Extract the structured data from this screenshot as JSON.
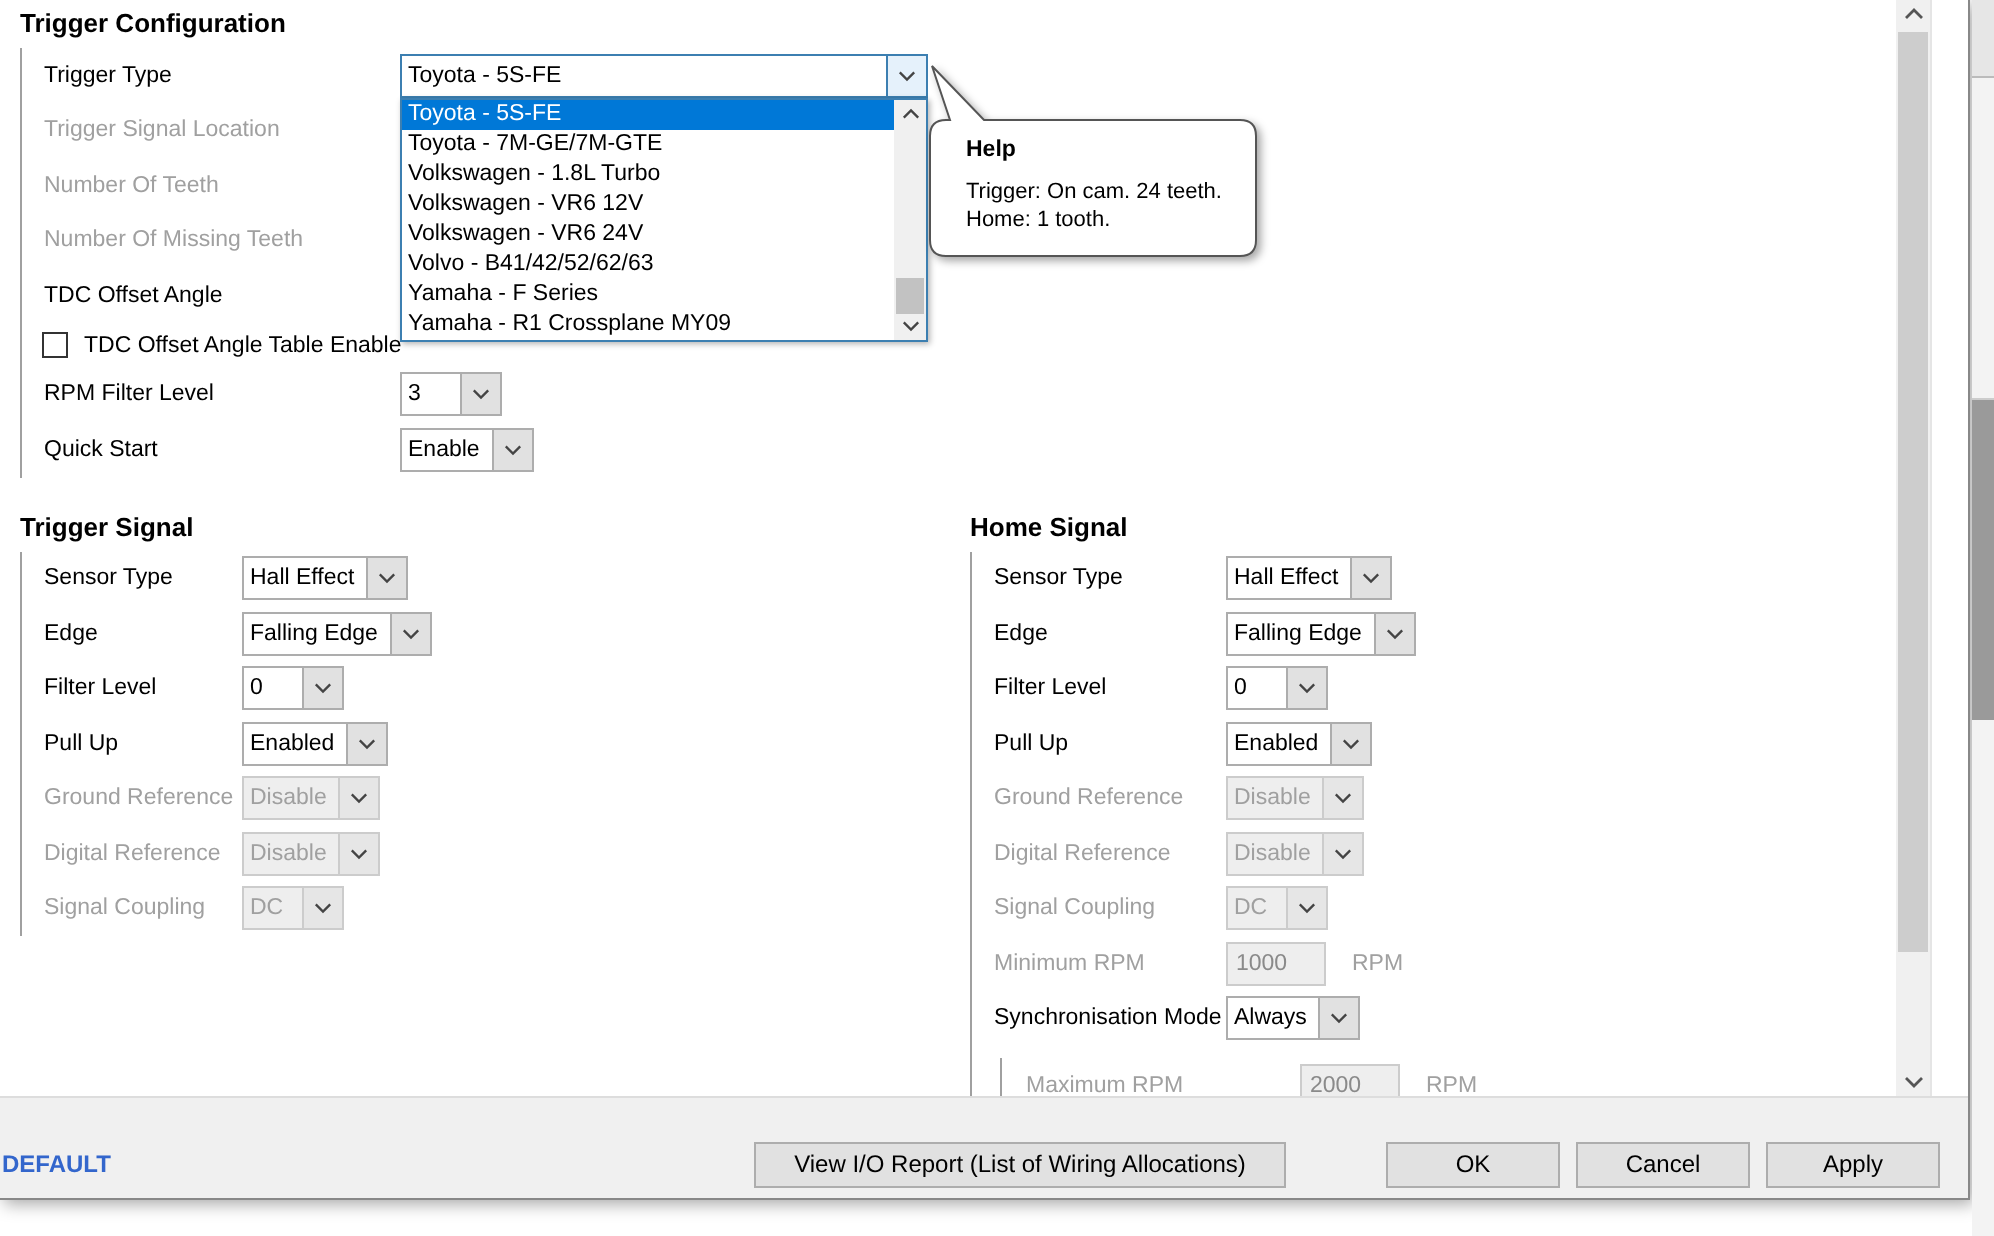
{
  "config": {
    "title": "Trigger Configuration",
    "rows": [
      {
        "kind": "combo",
        "label": "Trigger Type",
        "disabled": false,
        "value": "Toyota - 5S-FE",
        "expanded": true,
        "options": [
          {
            "label": "Toyota - 5S-FE",
            "selected": true
          },
          {
            "label": "Toyota - 7M-GE/7M-GTE",
            "selected": false
          },
          {
            "label": "Volkswagen - 1.8L Turbo",
            "selected": false
          },
          {
            "label": "Volkswagen - VR6 12V",
            "selected": false
          },
          {
            "label": "Volkswagen - VR6 24V",
            "selected": false
          },
          {
            "label": "Volvo - B41/42/52/62/63",
            "selected": false
          },
          {
            "label": "Yamaha - F Series",
            "selected": false
          },
          {
            "label": "Yamaha - R1 Crossplane MY09",
            "selected": false
          }
        ],
        "help": {
          "title": "Help",
          "lines": [
            "Trigger: On cam. 24 teeth.",
            "Home: 1 tooth."
          ]
        }
      },
      {
        "kind": "label",
        "label": "Trigger Signal Location",
        "disabled": true
      },
      {
        "kind": "label",
        "label": "Number Of Teeth",
        "disabled": true
      },
      {
        "kind": "label",
        "label": "Number Of Missing Teeth",
        "disabled": true
      },
      {
        "kind": "label",
        "label": "TDC Offset Angle",
        "disabled": false
      },
      {
        "kind": "checkbox",
        "label": "TDC Offset Angle Table Enable",
        "checked": false
      },
      {
        "kind": "combo",
        "label": "RPM Filter Level",
        "disabled": false,
        "value": "3",
        "expanded": false
      },
      {
        "kind": "combo",
        "label": "Quick Start",
        "disabled": false,
        "value": "Enable",
        "expanded": false
      }
    ]
  },
  "signals": [
    {
      "title": "Trigger Signal",
      "rows": [
        {
          "kind": "combo",
          "label": "Sensor Type",
          "disabled": false,
          "value": "Hall Effect",
          "expanded": false
        },
        {
          "kind": "combo",
          "label": "Edge",
          "disabled": false,
          "value": "Falling Edge",
          "expanded": false
        },
        {
          "kind": "combo",
          "label": "Filter Level",
          "disabled": false,
          "value": "0",
          "expanded": false
        },
        {
          "kind": "combo",
          "label": "Pull Up",
          "disabled": false,
          "value": "Enabled",
          "expanded": false
        },
        {
          "kind": "combo",
          "label": "Ground Reference",
          "disabled": true,
          "value": "Disable",
          "expanded": false
        },
        {
          "kind": "combo",
          "label": "Digital Reference",
          "disabled": true,
          "value": "Disable",
          "expanded": false
        },
        {
          "kind": "combo",
          "label": "Signal Coupling",
          "disabled": true,
          "value": "DC",
          "expanded": false
        }
      ]
    },
    {
      "title": "Home Signal",
      "rows": [
        {
          "kind": "combo",
          "label": "Sensor Type",
          "disabled": false,
          "value": "Hall Effect",
          "expanded": false
        },
        {
          "kind": "combo",
          "label": "Edge",
          "disabled": false,
          "value": "Falling Edge",
          "expanded": false
        },
        {
          "kind": "combo",
          "label": "Filter Level",
          "disabled": false,
          "value": "0",
          "expanded": false
        },
        {
          "kind": "combo",
          "label": "Pull Up",
          "disabled": false,
          "value": "Enabled",
          "expanded": false
        },
        {
          "kind": "combo",
          "label": "Ground Reference",
          "disabled": true,
          "value": "Disable",
          "expanded": false
        },
        {
          "kind": "combo",
          "label": "Digital Reference",
          "disabled": true,
          "value": "Disable",
          "expanded": false
        },
        {
          "kind": "combo",
          "label": "Signal Coupling",
          "disabled": true,
          "value": "DC",
          "expanded": false
        },
        {
          "kind": "number",
          "label": "Minimum RPM",
          "disabled": true,
          "value": "1000",
          "unit": "RPM"
        },
        {
          "kind": "combo",
          "label": "Synchronisation Mode",
          "disabled": false,
          "value": "Always",
          "expanded": false,
          "children": [
            {
              "kind": "number",
              "label": "Maximum RPM",
              "disabled": true,
              "value": "2000",
              "unit": "RPM"
            }
          ]
        }
      ]
    }
  ],
  "footer": {
    "link": "DEFAULT",
    "buttons": [
      {
        "kind": "wide",
        "label": "View I/O Report (List of Wiring Allocations)"
      },
      {
        "kind": "normal",
        "label": "OK"
      },
      {
        "kind": "normal",
        "label": "Cancel"
      },
      {
        "kind": "normal",
        "label": "Apply"
      }
    ]
  }
}
